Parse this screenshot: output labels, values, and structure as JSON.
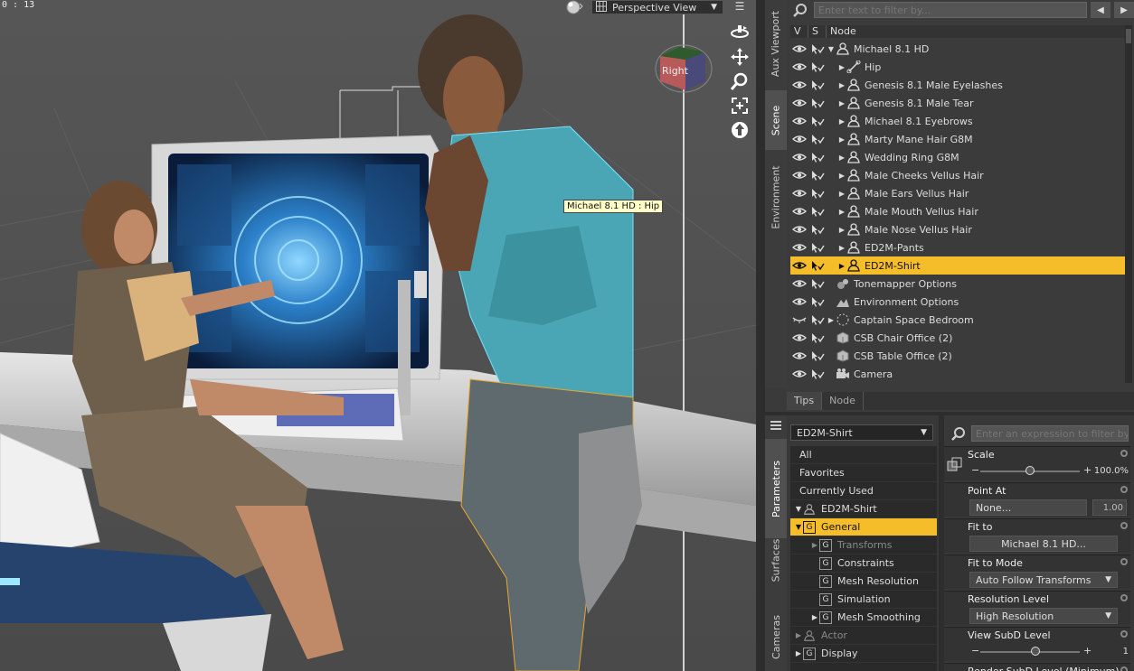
{
  "viewport": {
    "time": "0 : 13",
    "view_label": "Perspective View",
    "cube_label": "Right",
    "tooltip": "Michael 8.1 HD : Hip"
  },
  "side_tabs_top": [
    "Aux Viewport",
    "Scene",
    "Environment"
  ],
  "side_tabs_bottom": [
    "Parameters",
    "Surfaces",
    "Cameras"
  ],
  "scene": {
    "filter_placeholder": "Enter text to filter by...",
    "columns": [
      "V",
      "S",
      "Node"
    ],
    "rows": [
      {
        "label": "Michael 8.1 HD",
        "icon": "figure-icon",
        "indent": 0,
        "expand": "down"
      },
      {
        "label": "Hip",
        "icon": "bone-icon",
        "indent": 1,
        "expand": "right"
      },
      {
        "label": "Genesis 8.1 Male Eyelashes",
        "icon": "figure-icon",
        "indent": 1,
        "expand": "right"
      },
      {
        "label": "Genesis 8.1 Male Tear",
        "icon": "figure-icon",
        "indent": 1,
        "expand": "right"
      },
      {
        "label": "Michael 8.1 Eyebrows",
        "icon": "figure-icon",
        "indent": 1,
        "expand": "right"
      },
      {
        "label": "Marty Mane Hair G8M",
        "icon": "figure-icon",
        "indent": 1,
        "expand": "right"
      },
      {
        "label": "Wedding Ring G8M",
        "icon": "figure-icon",
        "indent": 1,
        "expand": "right"
      },
      {
        "label": "Male Cheeks Vellus Hair",
        "icon": "figure-icon",
        "indent": 1,
        "expand": "right"
      },
      {
        "label": "Male Ears Vellus Hair",
        "icon": "figure-icon",
        "indent": 1,
        "expand": "right"
      },
      {
        "label": "Male Mouth Vellus Hair",
        "icon": "figure-icon",
        "indent": 1,
        "expand": "right"
      },
      {
        "label": "Male Nose Vellus Hair",
        "icon": "figure-icon",
        "indent": 1,
        "expand": "right"
      },
      {
        "label": "ED2M-Pants",
        "icon": "figure-icon",
        "indent": 1,
        "expand": "right"
      },
      {
        "label": "ED2M-Shirt",
        "icon": "figure-icon",
        "indent": 1,
        "expand": "right",
        "selected": true
      },
      {
        "label": "Tonemapper Options",
        "icon": "tonemapper-icon",
        "indent": 0,
        "expand": ""
      },
      {
        "label": "Environment Options",
        "icon": "environment-icon",
        "indent": 0,
        "expand": ""
      },
      {
        "label": "Captain Space Bedroom",
        "icon": "group-icon",
        "indent": 0,
        "expand": "right",
        "hidden": true
      },
      {
        "label": "CSB Chair Office (2)",
        "icon": "prop-icon",
        "indent": 0,
        "expand": ""
      },
      {
        "label": "CSB Table Office (2)",
        "icon": "prop-icon",
        "indent": 0,
        "expand": ""
      },
      {
        "label": "Camera",
        "icon": "camera-icon",
        "indent": 0,
        "expand": ""
      }
    ],
    "bottom_tabs": [
      "Tips",
      "Node"
    ]
  },
  "params": {
    "node_select": "ED2M-Shirt",
    "list": [
      {
        "label": "All",
        "type": "plain"
      },
      {
        "label": "Favorites",
        "type": "plain"
      },
      {
        "label": "Currently Used",
        "type": "plain"
      },
      {
        "label": "ED2M-Shirt",
        "type": "node",
        "expand": "down"
      },
      {
        "label": "General",
        "type": "group",
        "expand": "down",
        "selected": true
      },
      {
        "label": "Transforms",
        "type": "group",
        "expand": "right",
        "dim": true,
        "indent": 1
      },
      {
        "label": "Constraints",
        "type": "group",
        "indent": 1
      },
      {
        "label": "Mesh Resolution",
        "type": "group",
        "indent": 1
      },
      {
        "label": "Simulation",
        "type": "group",
        "indent": 1
      },
      {
        "label": "Mesh Smoothing",
        "type": "group",
        "expand": "right",
        "indent": 1
      },
      {
        "label": "Actor",
        "type": "actor",
        "expand": "right",
        "dim": true
      },
      {
        "label": "Display",
        "type": "group",
        "expand": "right"
      }
    ],
    "filter_placeholder": "Enter an expression to filter by...",
    "props": [
      {
        "name": "Scale",
        "kind": "slider",
        "value": "100.0%",
        "fraction": 0.5
      },
      {
        "name": "Point At",
        "kind": "button_value",
        "button": "None...",
        "value": "1.00"
      },
      {
        "name": "Fit to",
        "kind": "button",
        "button": "Michael 8.1 HD..."
      },
      {
        "name": "Fit to Mode",
        "kind": "dropdown",
        "button": "Auto Follow Transforms"
      },
      {
        "name": "Resolution Level",
        "kind": "dropdown",
        "button": "High Resolution"
      },
      {
        "name": "View SubD Level",
        "kind": "slider",
        "value": "1",
        "fraction": 0.55
      },
      {
        "name": "Render SubD Level (Minimum)",
        "kind": "label"
      }
    ]
  },
  "colors": {
    "accent": "#f6bd2a",
    "panel": "#3b3b3b",
    "viewport": "#505050"
  }
}
